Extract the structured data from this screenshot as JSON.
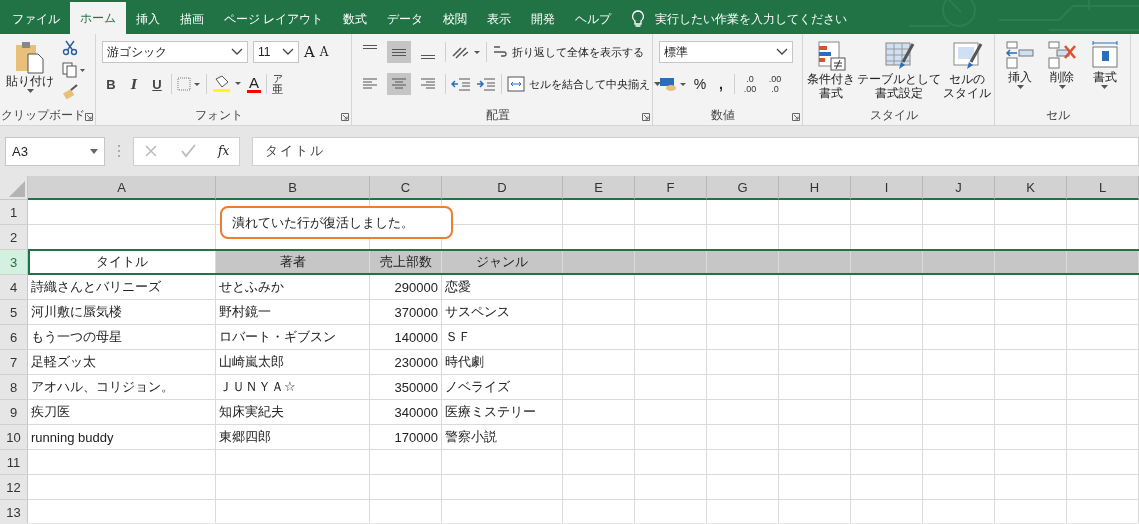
{
  "ribbon_tabs": [
    {
      "label": "ファイル",
      "selected": false
    },
    {
      "label": "ホーム",
      "selected": true
    },
    {
      "label": "挿入",
      "selected": false
    },
    {
      "label": "描画",
      "selected": false
    },
    {
      "label": "ページ レイアウト",
      "selected": false
    },
    {
      "label": "数式",
      "selected": false
    },
    {
      "label": "データ",
      "selected": false
    },
    {
      "label": "校閲",
      "selected": false
    },
    {
      "label": "表示",
      "selected": false
    },
    {
      "label": "開発",
      "selected": false
    },
    {
      "label": "ヘルプ",
      "selected": false
    }
  ],
  "tell_me": {
    "placeholder": "実行したい作業を入力してください"
  },
  "clipboard": {
    "paste": "貼り付け",
    "label": "クリップボード"
  },
  "font": {
    "name": "游ゴシック",
    "size": "11",
    "grow": "A",
    "shrink": "A",
    "styles": [
      "B",
      "I",
      "U"
    ],
    "color_glyph": "A",
    "ruby": "ア",
    "base": "亜",
    "label": "フォント"
  },
  "alignment": {
    "vertical": [
      {
        "selected": false
      },
      {
        "selected": true
      },
      {
        "selected": false
      }
    ],
    "horizontal": [
      {
        "selected": false
      },
      {
        "selected": true
      },
      {
        "selected": false
      }
    ],
    "wrap": "折り返して全体を表示する",
    "merge": "セルを結合して中央揃え",
    "label": "配置"
  },
  "number": {
    "format": "標準",
    "percent": "%",
    "comma": ",",
    "decimals": [
      {
        "top": ".0",
        "bottom": ".00"
      },
      {
        "top": ".00",
        "bottom": ".0"
      }
    ],
    "label": "数値"
  },
  "styles": {
    "buttons": [
      {
        "kind": "conditional",
        "lines": [
          "条件付き",
          "書式"
        ]
      },
      {
        "kind": "table",
        "lines": [
          "テーブルとして",
          "書式設定"
        ]
      },
      {
        "kind": "cellstyle",
        "lines": [
          "セルの",
          "スタイル"
        ]
      }
    ],
    "label": "スタイル"
  },
  "cells": {
    "buttons": [
      {
        "kind": "insert",
        "label": "挿入"
      },
      {
        "kind": "delete",
        "label": "削除"
      },
      {
        "kind": "format",
        "label": "書式"
      }
    ],
    "label": "セル"
  },
  "formula_bar": {
    "name_box": "A3",
    "fx": "fx",
    "value": "タイトル"
  },
  "columns": [
    "A",
    "B",
    "C",
    "D",
    "E",
    "F",
    "G",
    "H",
    "I",
    "J",
    "K",
    "L"
  ],
  "rows": [
    {
      "number": "1",
      "selected": false
    },
    {
      "number": "2",
      "selected": false
    },
    {
      "number": "3",
      "selected": true,
      "kind": "header",
      "cells": [
        "タイトル",
        "著者",
        "売上部数",
        "ジャンル"
      ]
    },
    {
      "number": "4",
      "selected": false,
      "cells": [
        "詩織さんとバリニーズ",
        "せとふみか",
        "290000",
        "恋愛"
      ]
    },
    {
      "number": "5",
      "selected": false,
      "cells": [
        "河川敷に蜃気楼",
        "野村鏡一",
        "370000",
        "サスペンス"
      ]
    },
    {
      "number": "6",
      "selected": false,
      "cells": [
        "もう一つの母星",
        "ロバート・ギブスン",
        "140000",
        "ＳＦ"
      ]
    },
    {
      "number": "7",
      "selected": false,
      "cells": [
        "足軽ズッ太",
        "山崎嵐太郎",
        "230000",
        "時代劇"
      ]
    },
    {
      "number": "8",
      "selected": false,
      "cells": [
        "アオハル、コリジョン。",
        "ＪＵＮＹＡ☆",
        "350000",
        "ノベライズ"
      ]
    },
    {
      "number": "9",
      "selected": false,
      "cells": [
        "疾刀医",
        "知床実紀夫",
        "340000",
        "医療ミステリー"
      ]
    },
    {
      "number": "10",
      "selected": false,
      "cells": [
        "running buddy",
        "東郷四郎",
        "170000",
        "警察小説"
      ]
    },
    {
      "number": "11",
      "selected": false
    },
    {
      "number": "12",
      "selected": false
    },
    {
      "number": "13",
      "selected": false
    }
  ],
  "toast": {
    "message": "潰れていた行が復活しました。"
  }
}
